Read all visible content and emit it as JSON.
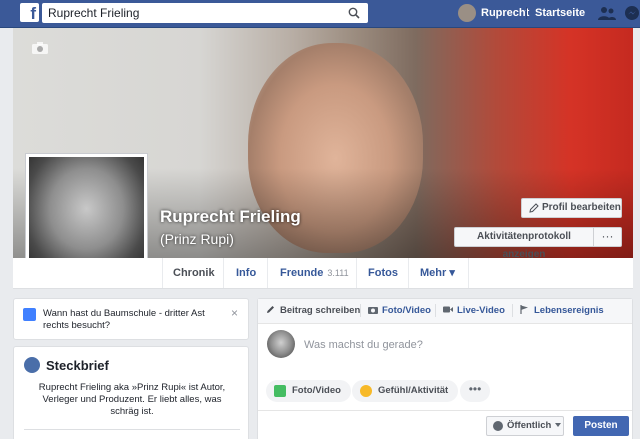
{
  "topbar": {
    "logo": "f",
    "search_value": "Ruprecht Frieling",
    "user_name": "Ruprecht",
    "home_label": "Startseite",
    "brand_color": "#3b5998"
  },
  "profile": {
    "name": "Ruprecht Frieling",
    "alternate_name": "(Prinz Rupi)",
    "edit_button": "Profil bearbeiten",
    "activity_button": "Aktivitätenprotokoll anzeigen",
    "more_button": "···"
  },
  "tabs": [
    {
      "label": "Chronik",
      "active": true
    },
    {
      "label": "Info"
    },
    {
      "label": "Freunde",
      "count": "3.111"
    },
    {
      "label": "Fotos"
    },
    {
      "label": "Mehr ▾"
    }
  ],
  "memory": {
    "text": "Wann hast du Baumschule - dritter Ast rechts besucht?",
    "close": "×"
  },
  "about": {
    "title": "Steckbrief",
    "text": "Ruprecht Frieling aka »Prinz Rupi« ist Autor, Verleger und Produzent. Er liebt alles, was schräg ist."
  },
  "composer": {
    "tabs": [
      "Beitrag schreiben",
      "Foto/Video",
      "Live-Video",
      "Lebensereignis"
    ],
    "placeholder": "Was machst du gerade?",
    "actions": [
      "Foto/Video",
      "Gefühl/Aktivität"
    ],
    "more": "•••",
    "audience": "Öffentlich",
    "post_button": "Posten"
  }
}
